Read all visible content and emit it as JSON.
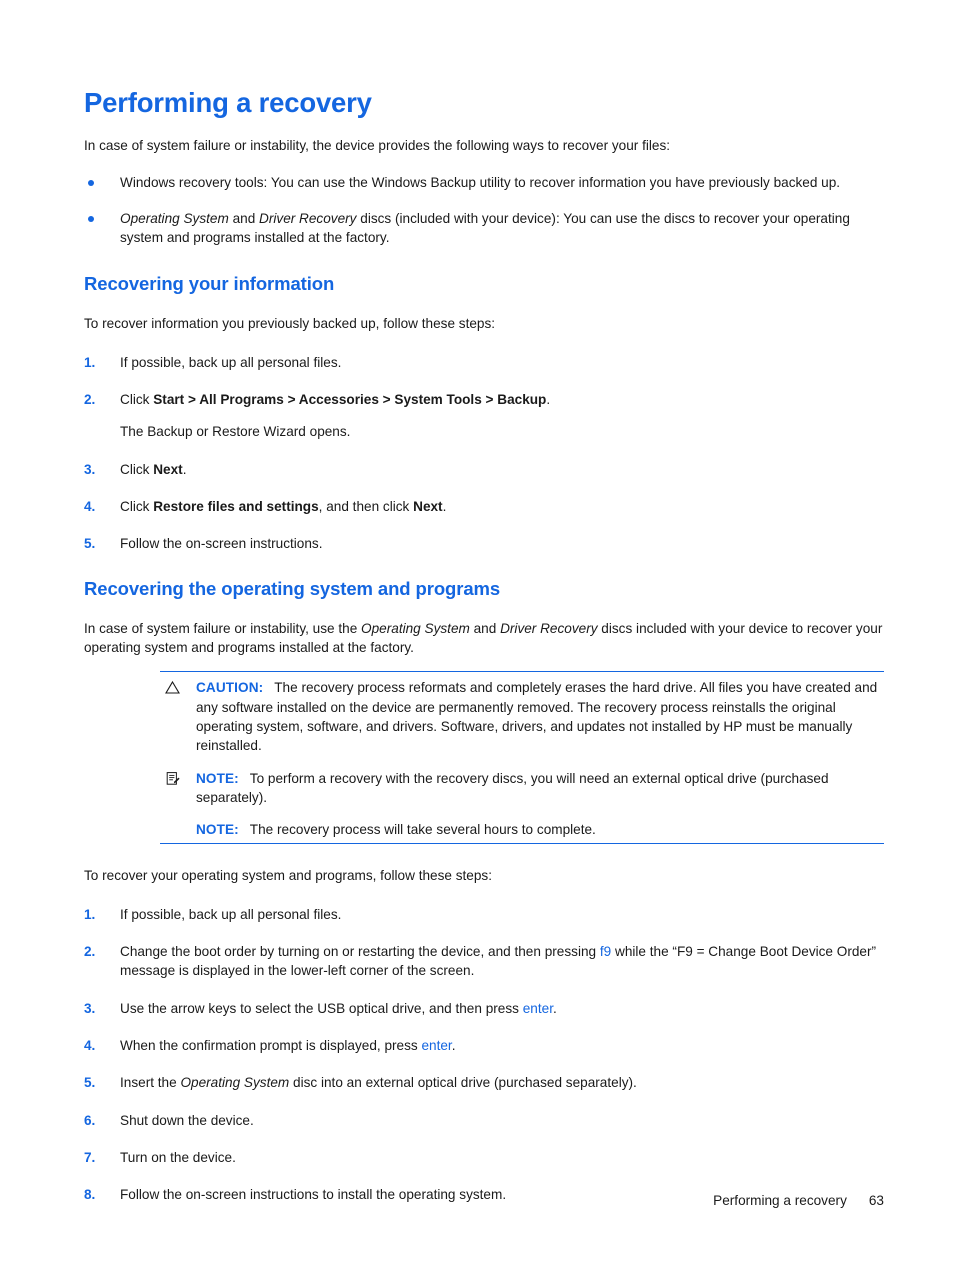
{
  "page": {
    "title": "Performing a recovery",
    "accent_color": "#1466e0",
    "text_color": "#1a1a1a",
    "background": "#ffffff"
  },
  "intro": {
    "paragraph": "In case of system failure or instability, the device provides the following ways to recover your files:",
    "bullets": [
      {
        "pre": "Windows recovery tools: You can use the Windows Backup utility to recover information you have previously backed up."
      },
      {
        "italic1": "Operating System",
        "mid": " and ",
        "italic2": "Driver Recovery",
        "post": " discs (included with your device): You can use the discs to recover your operating system and programs installed at the factory."
      }
    ]
  },
  "section_recovering_information": {
    "heading": "Recovering your information",
    "intro": "To recover information you previously backed up, follow these steps:",
    "steps": [
      {
        "num": "1.",
        "text": "If possible, back up all personal files."
      },
      {
        "num": "2.",
        "pre": "Click ",
        "bold": "Start > All Programs > Accessories > System Tools > Backup",
        "post": "."
      },
      {
        "num": "3.",
        "pre": "Click ",
        "bold": "Next",
        "post": "."
      },
      {
        "num": "4.",
        "pre": "Click ",
        "bold": "Restore files and settings",
        "mid": ", and then click ",
        "bold2": "Next",
        "post": "."
      },
      {
        "num": "5.",
        "text": "Follow the on-screen instructions."
      }
    ],
    "step2_result": "The Backup or Restore Wizard opens."
  },
  "section_recovering_os": {
    "heading": "Recovering the operating system and programs",
    "intro_pre": "In case of system failure or instability, use the ",
    "intro_italic1": "Operating System",
    "intro_mid": " and ",
    "intro_italic2": "Driver Recovery",
    "intro_post": " discs included with your device to recover your operating system and programs installed at the factory.",
    "admonitions": [
      {
        "icon": "caution-triangle-icon",
        "label": "CAUTION:",
        "text": "The recovery process reformats and completely erases the hard drive. All files you have created and any software installed on the device are permanently removed. The recovery process reinstalls the original operating system, software, and drivers. Software, drivers, and updates not installed by HP must be manually reinstalled."
      },
      {
        "icon": "note-document-icon",
        "label": "NOTE:",
        "text": "To perform a recovery with the recovery discs, you will need an external optical drive (purchased separately)."
      },
      {
        "icon": "",
        "label": "NOTE:",
        "text": "The recovery process will take several hours to complete."
      }
    ],
    "steps_intro": "To recover your operating system and programs, follow these steps:",
    "steps": [
      {
        "num": "1.",
        "text": "If possible, back up all personal files."
      },
      {
        "num": "2.",
        "pre": "Change the boot order by turning on or restarting the device, and then pressing ",
        "keyref": "f9",
        "post": " while the “F9 = Change Boot Device Order” message is displayed in the lower-left corner of the screen."
      },
      {
        "num": "3.",
        "pre": "Use the arrow keys to select the USB optical drive, and then press ",
        "keyref": "enter",
        "post": "."
      },
      {
        "num": "4.",
        "pre": "When the confirmation prompt is displayed, press ",
        "keyref": "enter",
        "post": "."
      },
      {
        "num": "5.",
        "pre": "Insert the ",
        "italic": "Operating System",
        "post": " disc into an external optical drive (purchased separately)."
      },
      {
        "num": "6.",
        "text": "Shut down the device."
      },
      {
        "num": "7.",
        "text": "Turn on the device."
      },
      {
        "num": "8.",
        "text": "Follow the on-screen instructions to install the operating system."
      }
    ]
  },
  "footer": {
    "chapter": "Performing a recovery",
    "page_number": "63"
  }
}
